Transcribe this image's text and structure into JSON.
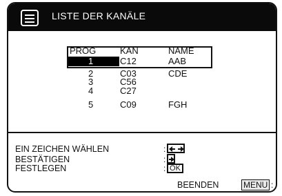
{
  "window": {
    "title": "LISTE DER KANÄLE",
    "icon": "list-icon"
  },
  "table": {
    "headers": {
      "prog": "PROG",
      "kan": "KAN",
      "name": "NAME"
    },
    "rows": [
      {
        "prog": "1",
        "kan": "C12",
        "name": "AAB",
        "selected": true
      },
      {
        "prog": "2",
        "kan": "C03",
        "name": "CDE",
        "selected": false
      },
      {
        "prog": "3",
        "kan": "C56",
        "name": "",
        "selected": false
      },
      {
        "prog": "4",
        "kan": "C27",
        "name": "",
        "selected": false
      },
      {
        "prog": "5",
        "kan": "C09",
        "name": "FGH",
        "selected": false
      }
    ]
  },
  "help": {
    "choose_char": "EIN ZEICHEN WÄHLEN",
    "confirm": "BESTÄTIGEN",
    "store": "FESTLEGEN",
    "colon": ":",
    "store_key": "OK",
    "choose_key_icon": "left-right-arrows-icon",
    "confirm_key_icon": "right-arrow-icon"
  },
  "footer": {
    "exit_label": "BEENDEN",
    "menu_key": "MENU",
    "colon": ":"
  },
  "colors": {
    "titlebar": "#0a0a0a",
    "selection": "#000000",
    "background": "#ffffff"
  }
}
